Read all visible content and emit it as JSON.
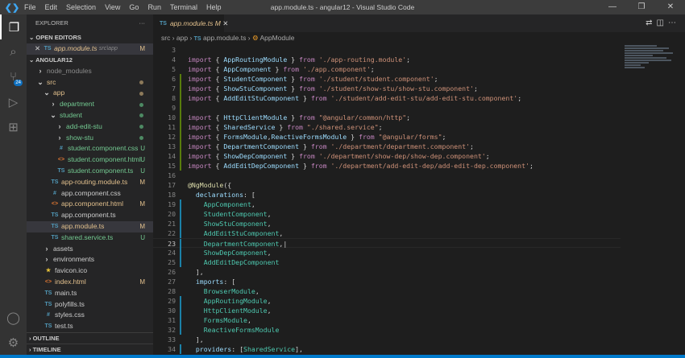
{
  "titlebar": {
    "menu": [
      "File",
      "Edit",
      "Selection",
      "View",
      "Go",
      "Run",
      "Terminal",
      "Help"
    ],
    "window_title": "app.module.ts - angular12 - Visual Studio Code"
  },
  "activity": {
    "scm_badge": "24"
  },
  "sidebar": {
    "header": "EXPLORER",
    "more": "···",
    "open_editors_label": "OPEN EDITORS",
    "open_editor": {
      "name": "app.module.ts",
      "path": "src\\app",
      "status": "M"
    },
    "root": "ANGULAR12",
    "tree": [
      {
        "name": "node_modules",
        "depth": 1,
        "kind": "folder",
        "open": false,
        "color": "gr"
      },
      {
        "name": "src",
        "depth": 1,
        "kind": "folder",
        "open": true,
        "color": "o",
        "dot": "#8d7a5a"
      },
      {
        "name": "app",
        "depth": 2,
        "kind": "folder",
        "open": true,
        "color": "o",
        "dot": "#8d7a5a"
      },
      {
        "name": "department",
        "depth": 3,
        "kind": "folder",
        "open": false,
        "color": "g",
        "dot": "#4d8a63"
      },
      {
        "name": "student",
        "depth": 3,
        "kind": "folder",
        "open": true,
        "color": "g",
        "dot": "#4d8a63"
      },
      {
        "name": "add-edit-stu",
        "depth": 4,
        "kind": "folder",
        "open": false,
        "color": "g",
        "dot": "#4d8a63"
      },
      {
        "name": "show-stu",
        "depth": 4,
        "kind": "folder",
        "open": false,
        "color": "g",
        "dot": "#4d8a63"
      },
      {
        "name": "student.component.css",
        "depth": 4,
        "kind": "css",
        "color": "g",
        "status": "U"
      },
      {
        "name": "student.component.html",
        "depth": 4,
        "kind": "html",
        "color": "g",
        "status": "U"
      },
      {
        "name": "student.component.ts",
        "depth": 4,
        "kind": "ts",
        "color": "g",
        "status": "U"
      },
      {
        "name": "app-routing.module.ts",
        "depth": 3,
        "kind": "ts",
        "color": "o",
        "status": "M"
      },
      {
        "name": "app.component.css",
        "depth": 3,
        "kind": "css",
        "color": "w"
      },
      {
        "name": "app.component.html",
        "depth": 3,
        "kind": "html",
        "color": "o",
        "status": "M"
      },
      {
        "name": "app.component.ts",
        "depth": 3,
        "kind": "ts",
        "color": "w"
      },
      {
        "name": "app.module.ts",
        "depth": 3,
        "kind": "ts",
        "color": "o",
        "status": "M",
        "selected": true
      },
      {
        "name": "shared.service.ts",
        "depth": 3,
        "kind": "ts",
        "color": "g",
        "status": "U"
      },
      {
        "name": "assets",
        "depth": 2,
        "kind": "folder",
        "open": false,
        "color": "w"
      },
      {
        "name": "environments",
        "depth": 2,
        "kind": "folder",
        "open": false,
        "color": "w"
      },
      {
        "name": "favicon.ico",
        "depth": 2,
        "kind": "star",
        "color": "w"
      },
      {
        "name": "index.html",
        "depth": 2,
        "kind": "html",
        "color": "o",
        "status": "M"
      },
      {
        "name": "main.ts",
        "depth": 2,
        "kind": "ts",
        "color": "w"
      },
      {
        "name": "polyfills.ts",
        "depth": 2,
        "kind": "ts",
        "color": "w"
      },
      {
        "name": "styles.css",
        "depth": 2,
        "kind": "css",
        "color": "w"
      },
      {
        "name": "test.ts",
        "depth": 2,
        "kind": "ts",
        "color": "w"
      }
    ],
    "outline_label": "OUTLINE",
    "timeline_label": "TIMELINE"
  },
  "editor": {
    "tab": {
      "name": "app.module.ts",
      "status": "M"
    },
    "breadcrumb": [
      "src",
      "app",
      "app.module.ts",
      "AppModule"
    ],
    "current_line": 23,
    "lines": [
      {
        "n": 3,
        "t": []
      },
      {
        "n": 4,
        "t": [
          [
            "k",
            "import"
          ],
          [
            "p",
            " { "
          ],
          [
            "v",
            "AppRoutingModule"
          ],
          [
            "p",
            " } "
          ],
          [
            "k",
            "from"
          ],
          [
            "p",
            " "
          ],
          [
            "s",
            "'./app-routing.module'"
          ],
          [
            "p",
            ";"
          ]
        ]
      },
      {
        "n": 5,
        "t": [
          [
            "k",
            "import"
          ],
          [
            "p",
            " { "
          ],
          [
            "v",
            "AppComponent"
          ],
          [
            "p",
            " } "
          ],
          [
            "k",
            "from"
          ],
          [
            "p",
            " "
          ],
          [
            "s",
            "'./app.component'"
          ],
          [
            "p",
            ";"
          ]
        ]
      },
      {
        "n": 6,
        "g": "#587c0c",
        "t": [
          [
            "k",
            "import"
          ],
          [
            "p",
            " { "
          ],
          [
            "v",
            "StudentComponent"
          ],
          [
            "p",
            " } "
          ],
          [
            "k",
            "from"
          ],
          [
            "p",
            " "
          ],
          [
            "s",
            "'./student/student.component'"
          ],
          [
            "p",
            ";"
          ]
        ]
      },
      {
        "n": 7,
        "g": "#587c0c",
        "t": [
          [
            "k",
            "import"
          ],
          [
            "p",
            " { "
          ],
          [
            "v",
            "ShowStuComponent"
          ],
          [
            "p",
            " } "
          ],
          [
            "k",
            "from"
          ],
          [
            "p",
            " "
          ],
          [
            "s",
            "'./student/show-stu/show-stu.component'"
          ],
          [
            "p",
            ";"
          ]
        ]
      },
      {
        "n": 8,
        "g": "#587c0c",
        "t": [
          [
            "k",
            "import"
          ],
          [
            "p",
            " { "
          ],
          [
            "v",
            "AddEditStuComponent"
          ],
          [
            "p",
            " } "
          ],
          [
            "k",
            "from"
          ],
          [
            "p",
            " "
          ],
          [
            "s",
            "'./student/add-edit-stu/add-edit-stu.component'"
          ],
          [
            "p",
            ";"
          ]
        ]
      },
      {
        "n": 9,
        "g": "#587c0c",
        "t": []
      },
      {
        "n": 10,
        "g": "#587c0c",
        "t": [
          [
            "k",
            "import"
          ],
          [
            "p",
            " { "
          ],
          [
            "v",
            "HttpClientModule"
          ],
          [
            "p",
            " } "
          ],
          [
            "k",
            "from"
          ],
          [
            "p",
            " "
          ],
          [
            "s",
            "\"@angular/common/http\""
          ],
          [
            "p",
            ";"
          ]
        ]
      },
      {
        "n": 11,
        "g": "#587c0c",
        "t": [
          [
            "k",
            "import"
          ],
          [
            "p",
            " { "
          ],
          [
            "v",
            "SharedService"
          ],
          [
            "p",
            " } "
          ],
          [
            "k",
            "from"
          ],
          [
            "p",
            " "
          ],
          [
            "s",
            "\"./shared.service\""
          ],
          [
            "p",
            ";"
          ]
        ]
      },
      {
        "n": 12,
        "g": "#587c0c",
        "t": [
          [
            "k",
            "import"
          ],
          [
            "p",
            " { "
          ],
          [
            "v",
            "FormsModule"
          ],
          [
            "p",
            ","
          ],
          [
            "v",
            "ReactiveFormsModule"
          ],
          [
            "p",
            " } "
          ],
          [
            "k",
            "from"
          ],
          [
            "p",
            " "
          ],
          [
            "s",
            "\"@angular/forms\""
          ],
          [
            "p",
            ";"
          ]
        ]
      },
      {
        "n": 13,
        "g": "#587c0c",
        "t": [
          [
            "k",
            "import"
          ],
          [
            "p",
            " { "
          ],
          [
            "v",
            "DepartmentComponent"
          ],
          [
            "p",
            " } "
          ],
          [
            "k",
            "from"
          ],
          [
            "p",
            " "
          ],
          [
            "s",
            "'./department/department.component'"
          ],
          [
            "p",
            ";"
          ]
        ]
      },
      {
        "n": 14,
        "g": "#587c0c",
        "t": [
          [
            "k",
            "import"
          ],
          [
            "p",
            " { "
          ],
          [
            "v",
            "ShowDepComponent"
          ],
          [
            "p",
            " } "
          ],
          [
            "k",
            "from"
          ],
          [
            "p",
            " "
          ],
          [
            "s",
            "'./department/show-dep/show-dep.component'"
          ],
          [
            "p",
            ";"
          ]
        ]
      },
      {
        "n": 15,
        "g": "#587c0c",
        "t": [
          [
            "k",
            "import"
          ],
          [
            "p",
            " { "
          ],
          [
            "v",
            "AddEditDepComponent"
          ],
          [
            "p",
            " } "
          ],
          [
            "k",
            "from"
          ],
          [
            "p",
            " "
          ],
          [
            "s",
            "'./department/add-edit-dep/add-edit-dep.component'"
          ],
          [
            "p",
            ";"
          ]
        ]
      },
      {
        "n": 16,
        "t": []
      },
      {
        "n": 17,
        "t": [
          [
            "f",
            "@NgModule"
          ],
          [
            "p",
            "({"
          ]
        ]
      },
      {
        "n": 18,
        "t": [
          [
            "p",
            "  "
          ],
          [
            "v",
            "declarations"
          ],
          [
            "p",
            ": ["
          ]
        ]
      },
      {
        "n": 19,
        "g": "#1b81a8",
        "t": [
          [
            "p",
            "    "
          ],
          [
            "c",
            "AppComponent"
          ],
          [
            "p",
            ","
          ]
        ]
      },
      {
        "n": 20,
        "g": "#1b81a8",
        "t": [
          [
            "p",
            "    "
          ],
          [
            "c",
            "StudentComponent"
          ],
          [
            "p",
            ","
          ]
        ]
      },
      {
        "n": 21,
        "g": "#1b81a8",
        "t": [
          [
            "p",
            "    "
          ],
          [
            "c",
            "ShowStuComponent"
          ],
          [
            "p",
            ","
          ]
        ]
      },
      {
        "n": 22,
        "g": "#1b81a8",
        "t": [
          [
            "p",
            "    "
          ],
          [
            "c",
            "AddEditStuComponent"
          ],
          [
            "p",
            ","
          ]
        ]
      },
      {
        "n": 23,
        "g": "#1b81a8",
        "t": [
          [
            "p",
            "    "
          ],
          [
            "c",
            "DepartmentComponent"
          ],
          [
            "p",
            ",|"
          ]
        ]
      },
      {
        "n": 24,
        "g": "#1b81a8",
        "t": [
          [
            "p",
            "    "
          ],
          [
            "c",
            "ShowDepComponent"
          ],
          [
            "p",
            ","
          ]
        ]
      },
      {
        "n": 25,
        "g": "#1b81a8",
        "t": [
          [
            "p",
            "    "
          ],
          [
            "c",
            "AddEditDepComponent"
          ]
        ]
      },
      {
        "n": 26,
        "t": [
          [
            "p",
            "  ],"
          ]
        ]
      },
      {
        "n": 27,
        "t": [
          [
            "p",
            "  "
          ],
          [
            "v",
            "imports"
          ],
          [
            "p",
            ": ["
          ]
        ]
      },
      {
        "n": 28,
        "t": [
          [
            "p",
            "    "
          ],
          [
            "c",
            "BrowserModule"
          ],
          [
            "p",
            ","
          ]
        ]
      },
      {
        "n": 29,
        "g": "#1b81a8",
        "t": [
          [
            "p",
            "    "
          ],
          [
            "c",
            "AppRoutingModule"
          ],
          [
            "p",
            ","
          ]
        ]
      },
      {
        "n": 30,
        "g": "#1b81a8",
        "t": [
          [
            "p",
            "    "
          ],
          [
            "c",
            "HttpClientModule"
          ],
          [
            "p",
            ","
          ]
        ]
      },
      {
        "n": 31,
        "g": "#1b81a8",
        "t": [
          [
            "p",
            "    "
          ],
          [
            "c",
            "FormsModule"
          ],
          [
            "p",
            ","
          ]
        ]
      },
      {
        "n": 32,
        "g": "#1b81a8",
        "t": [
          [
            "p",
            "    "
          ],
          [
            "c",
            "ReactiveFormsModule"
          ]
        ]
      },
      {
        "n": 33,
        "t": [
          [
            "p",
            "  ],"
          ]
        ]
      },
      {
        "n": 34,
        "g": "#1b81a8",
        "t": [
          [
            "p",
            "  "
          ],
          [
            "v",
            "providers"
          ],
          [
            "p",
            ": ["
          ],
          [
            "c",
            "SharedService"
          ],
          [
            "p",
            "],"
          ]
        ]
      }
    ]
  }
}
